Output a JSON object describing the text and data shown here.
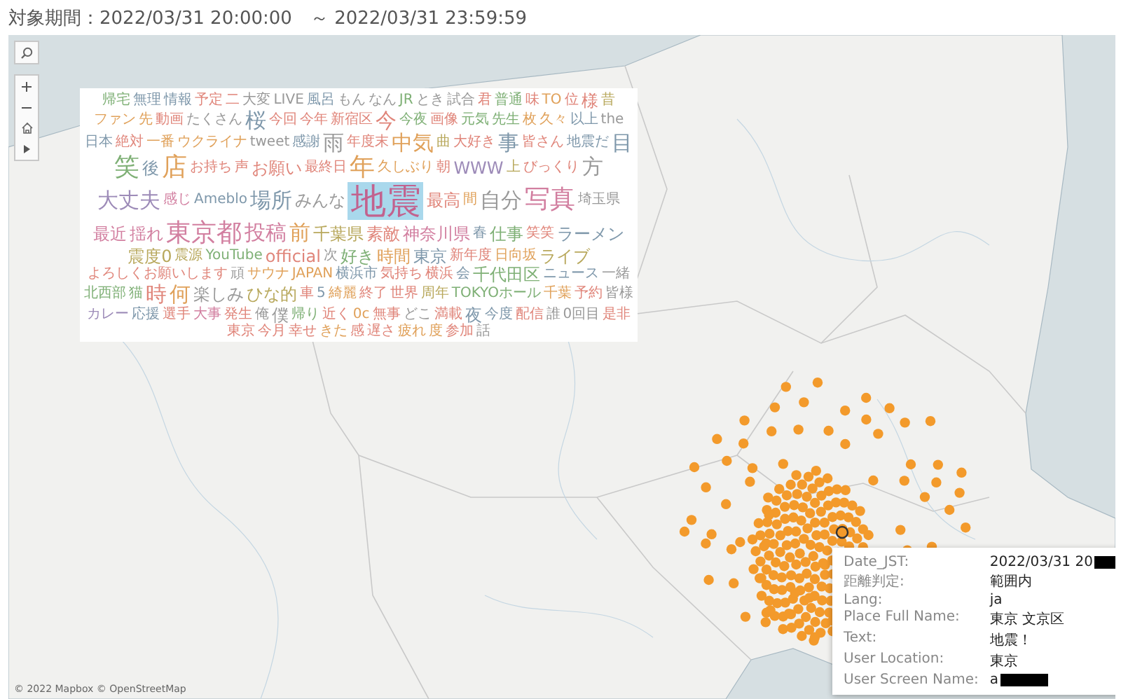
{
  "header": {
    "title": "対象期間：2022/03/31 20:00:00　～ 2022/03/31 23:59:59"
  },
  "word_cloud": {
    "words": [
      {
        "text": "帰宅",
        "kind": "xs",
        "color": "#7fb076",
        "selected": false
      },
      {
        "text": "無理",
        "kind": "xs",
        "color": "#7f98ab",
        "selected": false
      },
      {
        "text": "情報",
        "kind": "xs",
        "color": "#7f98ab",
        "selected": false
      },
      {
        "text": "予定",
        "kind": "s",
        "color": "#e0857a",
        "selected": false
      },
      {
        "text": "二",
        "kind": "s",
        "color": "#e0857a",
        "selected": false
      },
      {
        "text": "大変",
        "kind": "xs",
        "color": "#999999",
        "selected": false
      },
      {
        "text": "LIVE",
        "kind": "xs",
        "color": "#999999",
        "selected": false
      },
      {
        "text": "風呂",
        "kind": "xs",
        "color": "#7f98ab",
        "selected": false
      },
      {
        "text": "もん",
        "kind": "xs",
        "color": "#999999",
        "selected": false
      },
      {
        "text": "なん",
        "kind": "xs",
        "color": "#999999",
        "selected": false
      },
      {
        "text": "JR",
        "kind": "xs",
        "color": "#7fb076",
        "selected": false
      },
      {
        "text": "とき",
        "kind": "xs",
        "color": "#999999",
        "selected": false
      },
      {
        "text": "試合",
        "kind": "xs",
        "color": "#999999",
        "selected": false
      },
      {
        "text": "君",
        "kind": "xs",
        "color": "#e0857a",
        "selected": false
      },
      {
        "text": "普通",
        "kind": "xs",
        "color": "#7fb076",
        "selected": false
      },
      {
        "text": "味",
        "kind": "xs",
        "color": "#e0857a",
        "selected": false
      },
      {
        "text": "TO",
        "kind": "xs",
        "color": "#e0a15a",
        "selected": false
      },
      {
        "text": "位",
        "kind": "s",
        "color": "#e0857a",
        "selected": false
      },
      {
        "text": "様",
        "kind": "m",
        "color": "#e0857a",
        "selected": false
      },
      {
        "text": "昔",
        "kind": "xs",
        "color": "#b8a85c",
        "selected": false
      },
      {
        "text": "ファン",
        "kind": "xs",
        "color": "#e0a15a",
        "selected": false
      },
      {
        "text": "先",
        "kind": "xs",
        "color": "#e0a15a",
        "selected": false
      },
      {
        "text": "動画",
        "kind": "xs",
        "color": "#e0857a",
        "selected": false
      },
      {
        "text": "たくさん",
        "kind": "xs",
        "color": "#999999",
        "selected": false
      },
      {
        "text": "桜",
        "kind": "l",
        "color": "#7f98ab",
        "selected": false
      },
      {
        "text": "今回",
        "kind": "xs",
        "color": "#e0857a",
        "selected": false
      },
      {
        "text": "今年",
        "kind": "s",
        "color": "#e0857a",
        "selected": false
      },
      {
        "text": "新宿区",
        "kind": "xs",
        "color": "#e0857a",
        "selected": false
      },
      {
        "text": "今",
        "kind": "l",
        "color": "#e0857a",
        "selected": false
      },
      {
        "text": "今夜",
        "kind": "xs",
        "color": "#7fb076",
        "selected": false
      },
      {
        "text": "画像",
        "kind": "xs",
        "color": "#e0857a",
        "selected": false
      },
      {
        "text": "元気",
        "kind": "xs",
        "color": "#7fb076",
        "selected": false
      },
      {
        "text": "先生",
        "kind": "xs",
        "color": "#7fb076",
        "selected": false
      },
      {
        "text": "枚",
        "kind": "s",
        "color": "#e0a15a",
        "selected": false
      },
      {
        "text": "久々",
        "kind": "s",
        "color": "#e0a15a",
        "selected": false
      },
      {
        "text": "以上",
        "kind": "s",
        "color": "#7f98ab",
        "selected": false
      },
      {
        "text": "the",
        "kind": "xs",
        "color": "#999999",
        "selected": false
      },
      {
        "text": "日本",
        "kind": "s",
        "color": "#7f98ab",
        "selected": false
      },
      {
        "text": "絶対",
        "kind": "xs",
        "color": "#e0857a",
        "selected": false
      },
      {
        "text": "一番",
        "kind": "xs",
        "color": "#e0a15a",
        "selected": false
      },
      {
        "text": "ウクライナ",
        "kind": "xs",
        "color": "#e0a15a",
        "selected": false
      },
      {
        "text": "tweet",
        "kind": "xs",
        "color": "#999999",
        "selected": false
      },
      {
        "text": "感謝",
        "kind": "xs",
        "color": "#7f98ab",
        "selected": false
      },
      {
        "text": "雨",
        "kind": "l",
        "color": "#999999",
        "selected": false
      },
      {
        "text": "年度末",
        "kind": "xs",
        "color": "#e0857a",
        "selected": false
      },
      {
        "text": "中気",
        "kind": "l",
        "color": "#e0a15a",
        "selected": false
      },
      {
        "text": "曲",
        "kind": "xs",
        "color": "#b8a85c",
        "selected": false
      },
      {
        "text": "大好き",
        "kind": "xs",
        "color": "#e0857a",
        "selected": false
      },
      {
        "text": "事",
        "kind": "l",
        "color": "#7f98ab",
        "selected": false
      },
      {
        "text": "皆さん",
        "kind": "xs",
        "color": "#e0857a",
        "selected": false
      },
      {
        "text": "地震だ",
        "kind": "xs",
        "color": "#7f98ab",
        "selected": false
      },
      {
        "text": "目",
        "kind": "l",
        "color": "#7f98ab",
        "selected": false
      },
      {
        "text": "笑",
        "kind": "xl",
        "color": "#7fb076",
        "selected": false
      },
      {
        "text": "後",
        "kind": "m",
        "color": "#7f98ab",
        "selected": false
      },
      {
        "text": "店",
        "kind": "xl",
        "color": "#e0a15a",
        "selected": false
      },
      {
        "text": "お持ち",
        "kind": "xs",
        "color": "#e0857a",
        "selected": false
      },
      {
        "text": "声",
        "kind": "xs",
        "color": "#e0857a",
        "selected": false
      },
      {
        "text": "お願い",
        "kind": "m",
        "color": "#e0857a",
        "selected": false
      },
      {
        "text": "最終日",
        "kind": "s",
        "color": "#e0857a",
        "selected": false
      },
      {
        "text": "年",
        "kind": "xl",
        "color": "#e0a15a",
        "selected": false
      },
      {
        "text": "久しぶり",
        "kind": "s",
        "color": "#e0a15a",
        "selected": false
      },
      {
        "text": "朝",
        "kind": "xs",
        "color": "#e0857a",
        "selected": false
      },
      {
        "text": "WWW",
        "kind": "m",
        "color": "#9d8bb8",
        "selected": false
      },
      {
        "text": "上",
        "kind": "s",
        "color": "#b8a85c",
        "selected": false
      },
      {
        "text": "びっくり",
        "kind": "xs",
        "color": "#e0857a",
        "selected": false
      },
      {
        "text": "方",
        "kind": "l",
        "color": "#999999",
        "selected": false
      },
      {
        "text": "大丈夫",
        "kind": "l",
        "color": "#9d8bb8",
        "selected": false
      },
      {
        "text": "感じ",
        "kind": "s",
        "color": "#d27fa0",
        "selected": false
      },
      {
        "text": "Ameblo",
        "kind": "xs",
        "color": "#7f98ab",
        "selected": false
      },
      {
        "text": "場所",
        "kind": "l",
        "color": "#7f98ab",
        "selected": false
      },
      {
        "text": "みんな",
        "kind": "m",
        "color": "#999999",
        "selected": false
      },
      {
        "text": "地震",
        "kind": "xxl",
        "color": "#c2628e",
        "selected": true
      },
      {
        "text": "最高",
        "kind": "m",
        "color": "#e0857a",
        "selected": false
      },
      {
        "text": "間",
        "kind": "s",
        "color": "#e0a15a",
        "selected": false
      },
      {
        "text": "自分",
        "kind": "l",
        "color": "#999999",
        "selected": false
      },
      {
        "text": "写真",
        "kind": "xl",
        "color": "#d27fa0",
        "selected": false
      },
      {
        "text": "埼玉県",
        "kind": "xs",
        "color": "#999999",
        "selected": false
      },
      {
        "text": "最近",
        "kind": "m",
        "color": "#d27fa0",
        "selected": false
      },
      {
        "text": "揺れ",
        "kind": "m",
        "color": "#d27fa0",
        "selected": false
      },
      {
        "text": "東京都",
        "kind": "xl",
        "color": "#d27fa0",
        "selected": false
      },
      {
        "text": "投稿",
        "kind": "l",
        "color": "#d27fa0",
        "selected": false
      },
      {
        "text": "前",
        "kind": "l",
        "color": "#e0a15a",
        "selected": false
      },
      {
        "text": "千葉県",
        "kind": "m",
        "color": "#b8a85c",
        "selected": false
      },
      {
        "text": "素敵",
        "kind": "m",
        "color": "#e0857a",
        "selected": false
      },
      {
        "text": "神奈川県",
        "kind": "m",
        "color": "#d27fa0",
        "selected": false
      },
      {
        "text": "春",
        "kind": "s",
        "color": "#7f98ab",
        "selected": false
      },
      {
        "text": "仕事",
        "kind": "m",
        "color": "#7fb076",
        "selected": false
      },
      {
        "text": "笑笑",
        "kind": "s",
        "color": "#e0857a",
        "selected": false
      },
      {
        "text": "ラーメン",
        "kind": "m",
        "color": "#7f98ab",
        "selected": false
      },
      {
        "text": "震度0",
        "kind": "m",
        "color": "#b8a85c",
        "selected": false
      },
      {
        "text": "震源",
        "kind": "s",
        "color": "#b8a85c",
        "selected": false
      },
      {
        "text": "YouTube",
        "kind": "s",
        "color": "#7fb076",
        "selected": false
      },
      {
        "text": "official",
        "kind": "m",
        "color": "#e0857a",
        "selected": false
      },
      {
        "text": "次",
        "kind": "s",
        "color": "#999999",
        "selected": false
      },
      {
        "text": "好き",
        "kind": "m",
        "color": "#7fb076",
        "selected": false
      },
      {
        "text": "時間",
        "kind": "m",
        "color": "#e0a15a",
        "selected": false
      },
      {
        "text": "東京",
        "kind": "m",
        "color": "#7f98ab",
        "selected": false
      },
      {
        "text": "新年度",
        "kind": "xs",
        "color": "#e0857a",
        "selected": false
      },
      {
        "text": "日向坂",
        "kind": "s",
        "color": "#e0a15a",
        "selected": false
      },
      {
        "text": "ライブ",
        "kind": "m",
        "color": "#b8a85c",
        "selected": false
      },
      {
        "text": "よろしくお願いします",
        "kind": "xs",
        "color": "#e0857a",
        "selected": false
      },
      {
        "text": "頑",
        "kind": "xs",
        "color": "#999999",
        "selected": false
      },
      {
        "text": "サウナ",
        "kind": "xs",
        "color": "#e0a15a",
        "selected": false
      },
      {
        "text": "JAPAN",
        "kind": "xs",
        "color": "#e0a15a",
        "selected": false
      },
      {
        "text": "横浜市",
        "kind": "s",
        "color": "#7f98ab",
        "selected": false
      },
      {
        "text": "気持ち",
        "kind": "xs",
        "color": "#e0857a",
        "selected": false
      },
      {
        "text": "横浜",
        "kind": "s",
        "color": "#e0857a",
        "selected": false
      },
      {
        "text": "会",
        "kind": "s",
        "color": "#7f98ab",
        "selected": false
      },
      {
        "text": "千代田区",
        "kind": "m",
        "color": "#7fb076",
        "selected": false
      },
      {
        "text": "ニュース",
        "kind": "xs",
        "color": "#7f98ab",
        "selected": false
      },
      {
        "text": "一緒",
        "kind": "xs",
        "color": "#999999",
        "selected": false
      },
      {
        "text": "北西部",
        "kind": "s",
        "color": "#7fb076",
        "selected": false
      },
      {
        "text": "猫",
        "kind": "s",
        "color": "#7fb076",
        "selected": false
      },
      {
        "text": "時",
        "kind": "l",
        "color": "#e0857a",
        "selected": false
      },
      {
        "text": "何",
        "kind": "l",
        "color": "#e0a15a",
        "selected": false
      },
      {
        "text": "楽しみ",
        "kind": "m",
        "color": "#999999",
        "selected": false
      },
      {
        "text": "ひな的",
        "kind": "m",
        "color": "#b8a85c",
        "selected": false
      },
      {
        "text": "車",
        "kind": "xs",
        "color": "#e0857a",
        "selected": false
      },
      {
        "text": "5",
        "kind": "xs",
        "color": "#7f98ab",
        "selected": false
      },
      {
        "text": "綺麗",
        "kind": "xs",
        "color": "#e0a15a",
        "selected": false
      },
      {
        "text": "終了",
        "kind": "xs",
        "color": "#e0857a",
        "selected": false
      },
      {
        "text": "世界",
        "kind": "xs",
        "color": "#e0857a",
        "selected": false
      },
      {
        "text": "周年",
        "kind": "xs",
        "color": "#b8a85c",
        "selected": false
      },
      {
        "text": "TOKYOホール",
        "kind": "xs",
        "color": "#7fb076",
        "selected": false
      },
      {
        "text": "千葉",
        "kind": "xs",
        "color": "#e0a15a",
        "selected": false
      },
      {
        "text": "予約",
        "kind": "xs",
        "color": "#e0857a",
        "selected": false
      },
      {
        "text": "皆様",
        "kind": "xs",
        "color": "#999999",
        "selected": false
      },
      {
        "text": "カレー",
        "kind": "xs",
        "color": "#9d8bb8",
        "selected": false
      },
      {
        "text": "応援",
        "kind": "s",
        "color": "#7f98ab",
        "selected": false
      },
      {
        "text": "選手",
        "kind": "s",
        "color": "#e0857a",
        "selected": false
      },
      {
        "text": "大事",
        "kind": "s",
        "color": "#d27fa0",
        "selected": false
      },
      {
        "text": "発生",
        "kind": "xs",
        "color": "#e0857a",
        "selected": false
      },
      {
        "text": "俺",
        "kind": "s",
        "color": "#999999",
        "selected": false
      },
      {
        "text": "僕",
        "kind": "m",
        "color": "#999999",
        "selected": false
      },
      {
        "text": "帰り",
        "kind": "xs",
        "color": "#7fb076",
        "selected": false
      },
      {
        "text": "近く",
        "kind": "xs",
        "color": "#e0857a",
        "selected": false
      },
      {
        "text": "0c",
        "kind": "xs",
        "color": "#e0a15a",
        "selected": false
      },
      {
        "text": "無事",
        "kind": "xs",
        "color": "#e0857a",
        "selected": false
      },
      {
        "text": "どこ",
        "kind": "xs",
        "color": "#999999",
        "selected": false
      },
      {
        "text": "満載",
        "kind": "xs",
        "color": "#e0857a",
        "selected": false
      },
      {
        "text": "夜",
        "kind": "m",
        "color": "#7f98ab",
        "selected": false
      },
      {
        "text": "今度",
        "kind": "xs",
        "color": "#7f98ab",
        "selected": false
      },
      {
        "text": "配信",
        "kind": "xs",
        "color": "#e0857a",
        "selected": false
      },
      {
        "text": "誰",
        "kind": "xs",
        "color": "#999999",
        "selected": false
      },
      {
        "text": "0回目",
        "kind": "xs",
        "color": "#999999",
        "selected": false
      },
      {
        "text": "是非",
        "kind": "xs",
        "color": "#e0857a",
        "selected": false
      },
      {
        "text": "東京",
        "kind": "xs",
        "color": "#e0857a",
        "selected": false
      },
      {
        "text": "今月",
        "kind": "xs",
        "color": "#e0857a",
        "selected": false
      },
      {
        "text": "幸せ",
        "kind": "xs",
        "color": "#e0857a",
        "selected": false
      },
      {
        "text": "きた",
        "kind": "xs",
        "color": "#e0a15a",
        "selected": false
      },
      {
        "text": "感",
        "kind": "xs",
        "color": "#e0857a",
        "selected": false
      },
      {
        "text": "遅さ",
        "kind": "xs",
        "color": "#e0857a",
        "selected": false
      },
      {
        "text": "疲れ",
        "kind": "xs",
        "color": "#e0a15a",
        "selected": false
      },
      {
        "text": "度",
        "kind": "xs",
        "color": "#e0a15a",
        "selected": false
      },
      {
        "text": "参加",
        "kind": "xs",
        "color": "#e0857a",
        "selected": false
      },
      {
        "text": "話",
        "kind": "xs",
        "color": "#999999",
        "selected": false
      }
    ]
  },
  "tooltip": {
    "rows": [
      {
        "label": "Date_JST:",
        "value": "2022/03/31 20",
        "redacted": true
      },
      {
        "label": "距離判定:",
        "value": "範囲内",
        "redacted": false
      },
      {
        "label": "Lang:",
        "value": "ja",
        "redacted": false
      },
      {
        "label": "Place Full Name:",
        "value": "東京 文京区",
        "redacted": false
      },
      {
        "label": "Text:",
        "value": "地震！",
        "redacted": false
      },
      {
        "label": "User Location:",
        "value": "東京",
        "redacted": false
      },
      {
        "label": "User Screen Name:",
        "value": "a",
        "redacted": true
      }
    ]
  },
  "attribution": "© 2022 Mapbox © OpenStreetMap"
}
